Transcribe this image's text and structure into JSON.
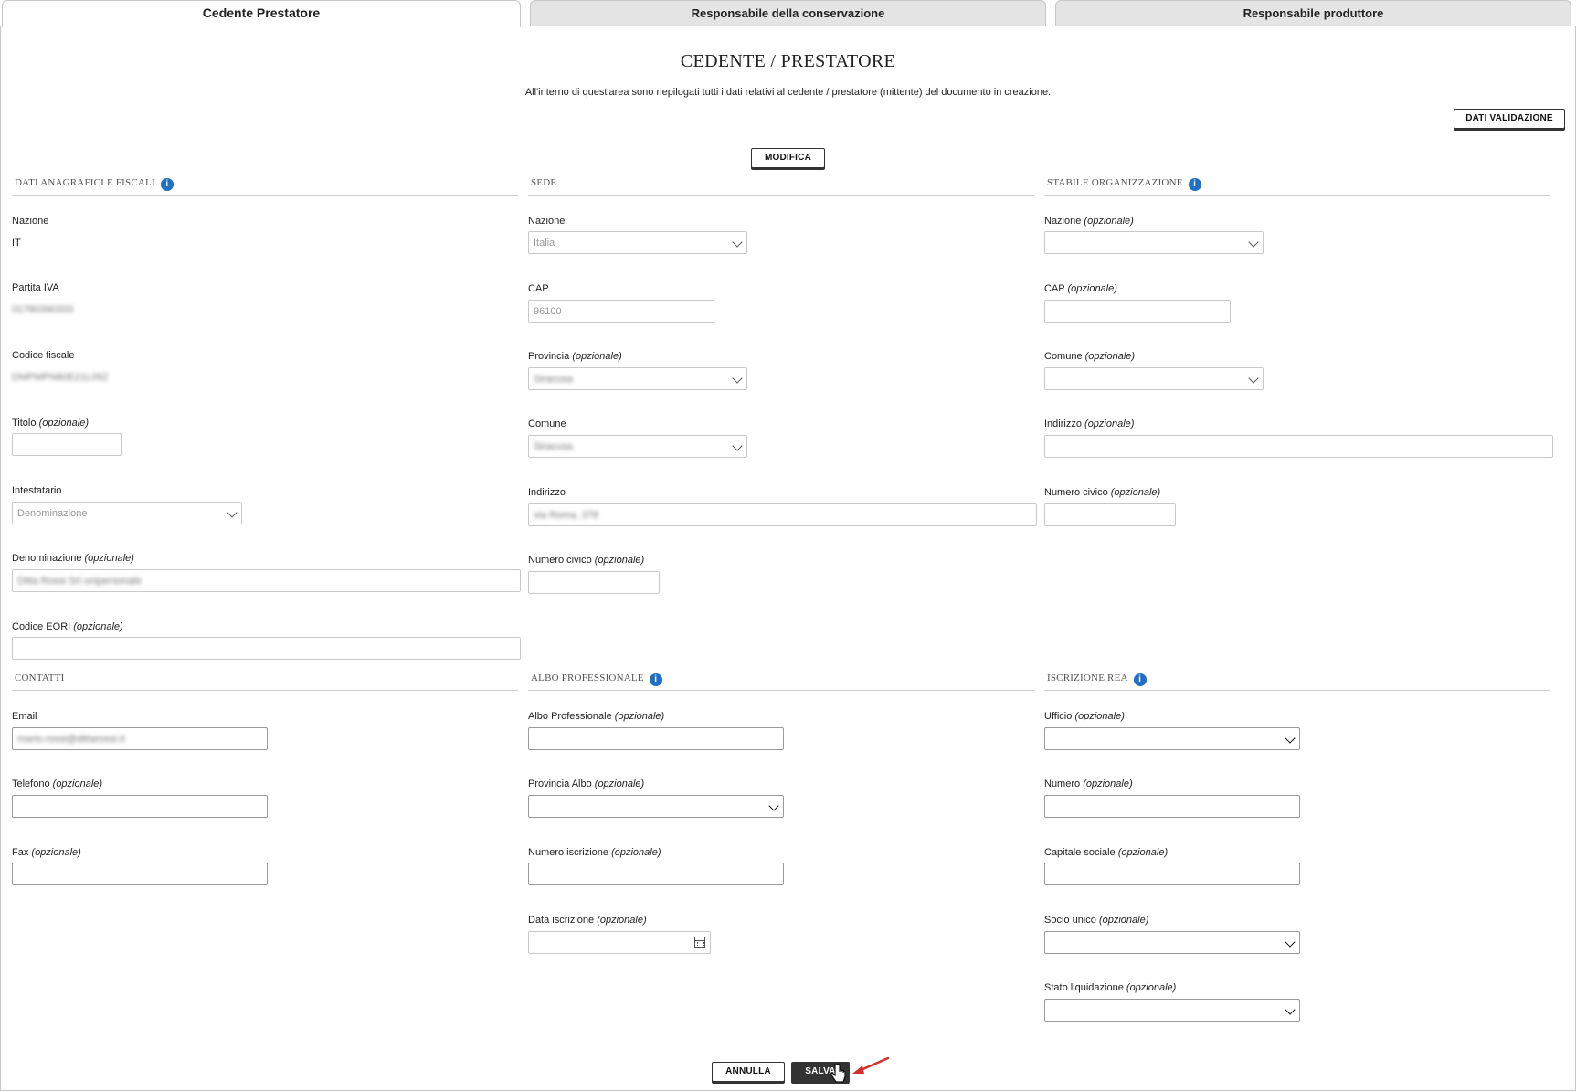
{
  "tabs": [
    {
      "label": "Cedente Prestatore",
      "active": true
    },
    {
      "label": "Responsabile della conservazione",
      "active": false
    },
    {
      "label": "Responsabile produttore",
      "active": false
    }
  ],
  "header": {
    "title": "CEDENTE / PRESTATORE",
    "subtitle": "All'interno di quest'area sono riepilogati tutti i dati relativi al cedente / prestatore (mittente) del documento in creazione."
  },
  "buttons": {
    "dati_validazione": "DATI VALIDAZIONE",
    "modifica": "MODIFICA",
    "annulla": "ANNULLA",
    "salva": "SALVA"
  },
  "optional_suffix": "(opzionale)",
  "anagrafici": {
    "title": "DATI ANAGRAFICI E FISCALI",
    "nazione_label": "Nazione",
    "nazione_value": "IT",
    "piva_label": "Partita IVA",
    "piva_value": "01780390333",
    "cf_label": "Codice fiscale",
    "cf_value": "DMPMPN80E21L09Z",
    "titolo_label": "Titolo",
    "titolo_value": "",
    "intestatario_label": "Intestatario",
    "intestatario_value": "Denominazione",
    "denominazione_label": "Denominazione",
    "denominazione_value": "Ditta Rossi Srl unipersonale",
    "eori_label": "Codice EORI",
    "eori_value": ""
  },
  "sede": {
    "title": "SEDE",
    "nazione_label": "Nazione",
    "nazione_value": "Italia",
    "cap_label": "CAP",
    "cap_value": "96100",
    "provincia_label": "Provincia",
    "provincia_value": "Siracusa",
    "comune_label": "Comune",
    "comune_value": "Siracusa",
    "indirizzo_label": "Indirizzo",
    "indirizzo_value": "via Roma, 378",
    "civico_label": "Numero civico",
    "civico_value": ""
  },
  "stabile": {
    "title": "STABILE ORGANIZZAZIONE",
    "nazione_label": "Nazione",
    "cap_label": "CAP",
    "comune_label": "Comune",
    "indirizzo_label": "Indirizzo",
    "civico_label": "Numero civico"
  },
  "contatti": {
    "title": "CONTATTI",
    "email_label": "Email",
    "email_value": "mario.rossi@dittarossi.it",
    "telefono_label": "Telefono",
    "fax_label": "Fax"
  },
  "albo": {
    "title": "ALBO PROFESSIONALE",
    "albo_label": "Albo Professionale",
    "provincia_label": "Provincia Albo",
    "numero_label": "Numero iscrizione",
    "data_label": "Data iscrizione"
  },
  "rea": {
    "title": "ISCRIZIONE REA",
    "ufficio_label": "Ufficio",
    "numero_label": "Numero",
    "capitale_label": "Capitale sociale",
    "socio_label": "Socio unico",
    "stato_label": "Stato liquidazione"
  },
  "colors": {
    "info_icon": "#1f6fc5",
    "arrow": "#d32f2f",
    "dark_button": "#333333"
  }
}
